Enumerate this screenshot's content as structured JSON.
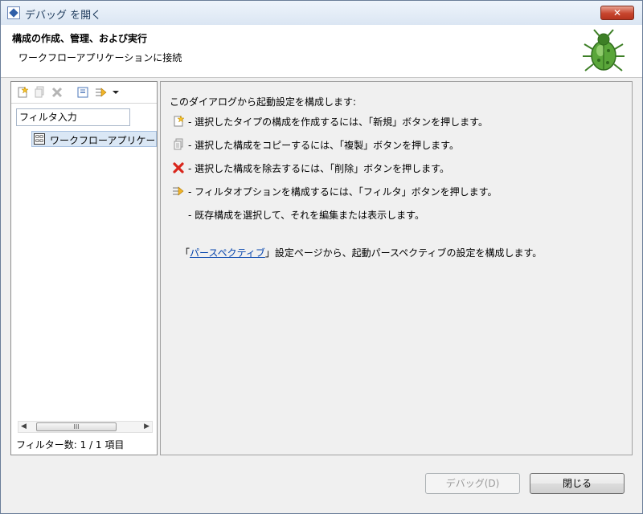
{
  "window": {
    "title": "デバッグ を開く",
    "close_label": "✕"
  },
  "header": {
    "title": "構成の作成、管理、および実行",
    "description": "ワークフローアプリケーションに接続"
  },
  "left": {
    "filter_placeholder": "フィルタ入力",
    "tree_items": [
      {
        "label": "ワークフローアプリケーション"
      }
    ],
    "scroll_thumb": "III",
    "filter_count": "フィルター数: 1 / 1 項目"
  },
  "right": {
    "intro": "このダイアログから起動設定を構成します:",
    "lines": [
      {
        "icon": "new-config-icon",
        "text": "- 選択したタイプの構成を作成するには、「新規」ボタンを押します。"
      },
      {
        "icon": "duplicate-icon",
        "text": "- 選択した構成をコピーするには、「複製」ボタンを押します。"
      },
      {
        "icon": "delete-icon",
        "text": "- 選択した構成を除去するには、「削除」ボタンを押します。"
      },
      {
        "icon": "filter-icon",
        "text": "- フィルタオプションを構成するには、「フィルタ」ボタンを押します。"
      },
      {
        "icon": "",
        "text": "- 既存構成を選択して、それを編集または表示します。"
      }
    ],
    "perspective_prefix": "「",
    "perspective_link": "パースペクティブ",
    "perspective_suffix": "」設定ページから、起動パースペクティブの設定を構成します。"
  },
  "buttons": {
    "debug": "デバッグ(D)",
    "close": "閉じる"
  },
  "colors": {
    "link": "#0645ad",
    "close_button": "#c7452e",
    "selection": "#dae7f5",
    "delete_red": "#d9261c"
  }
}
